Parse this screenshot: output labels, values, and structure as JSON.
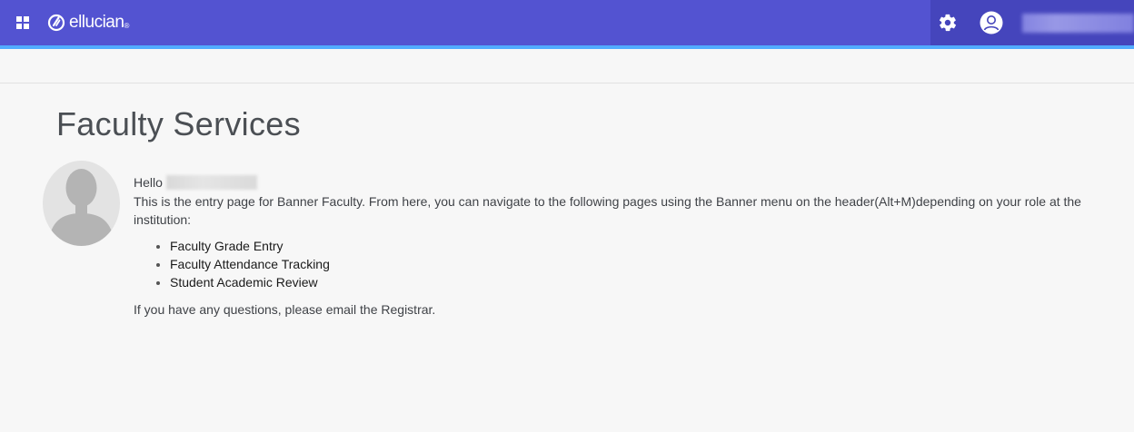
{
  "header": {
    "brand": "ellucian",
    "brand_mark": "®",
    "icons": {
      "apps": "apps-grid-icon",
      "brand_logo": "ellucian-logo-icon",
      "settings": "gear-icon",
      "profile": "user-icon"
    },
    "colors": {
      "bar": "#5353d1",
      "bar_right": "#4545bc",
      "accent_line": "#51abff"
    }
  },
  "main": {
    "title": "Faculty Services",
    "greeting": "Hello",
    "intro": "This is the entry page for Banner Faculty. From here, you can navigate to the following pages using the Banner menu on the header(Alt+M)depending on your role at the institution:",
    "pages": [
      "Faculty Grade Entry",
      "Faculty Attendance Tracking",
      "Student Academic Review"
    ],
    "closing": "If you have any questions, please email the Registrar."
  }
}
